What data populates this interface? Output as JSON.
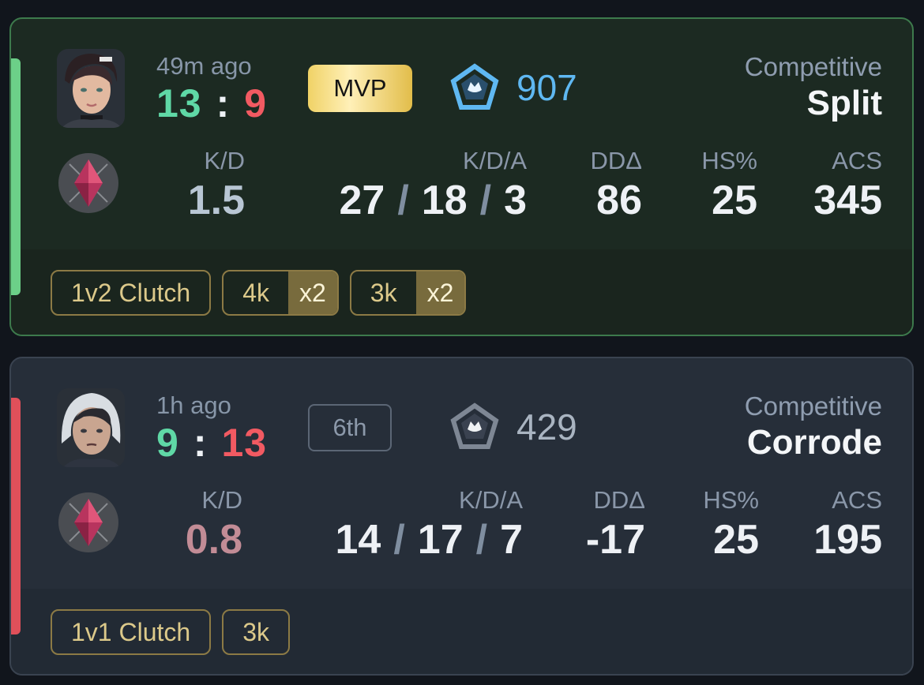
{
  "matches": [
    {
      "result": "win",
      "time": "49m ago",
      "score": {
        "team": "13",
        "separator": ":",
        "enemy": "9"
      },
      "placement": "MVP",
      "rank_rating": "907",
      "mode": "Competitive",
      "map": "Split",
      "stats": {
        "kd_label": "K/D",
        "kd": "1.5",
        "kda_label": "K/D/A",
        "kills": "27",
        "deaths": "18",
        "assists": "3",
        "slash": "/",
        "dd_label": "DDΔ",
        "dd": "86",
        "hs_label": "HS%",
        "hs": "25",
        "acs_label": "ACS",
        "acs": "345"
      },
      "badges": [
        {
          "text": "1v2 Clutch",
          "mult": ""
        },
        {
          "text": "4k",
          "mult": "x2"
        },
        {
          "text": "3k",
          "mult": "x2"
        }
      ],
      "colors": {
        "accent": "#6cd088",
        "rank": "#5fb8f2"
      }
    },
    {
      "result": "loss",
      "time": "1h ago",
      "score": {
        "team": "9",
        "separator": ":",
        "enemy": "13"
      },
      "placement": "6th",
      "rank_rating": "429",
      "mode": "Competitive",
      "map": "Corrode",
      "stats": {
        "kd_label": "K/D",
        "kd": "0.8",
        "kda_label": "K/D/A",
        "kills": "14",
        "deaths": "17",
        "assists": "7",
        "slash": "/",
        "dd_label": "DDΔ",
        "dd": "-17",
        "hs_label": "HS%",
        "hs": "25",
        "acs_label": "ACS",
        "acs": "195"
      },
      "badges": [
        {
          "text": "1v1 Clutch",
          "mult": ""
        },
        {
          "text": "3k",
          "mult": ""
        }
      ],
      "colors": {
        "accent": "#e0505a",
        "rank": "#a9b4c1"
      }
    }
  ],
  "icons": {
    "avatar": "agent-portrait-icon",
    "agent_role": "role-diamond-icon",
    "rank": "rank-emblem-icon"
  }
}
